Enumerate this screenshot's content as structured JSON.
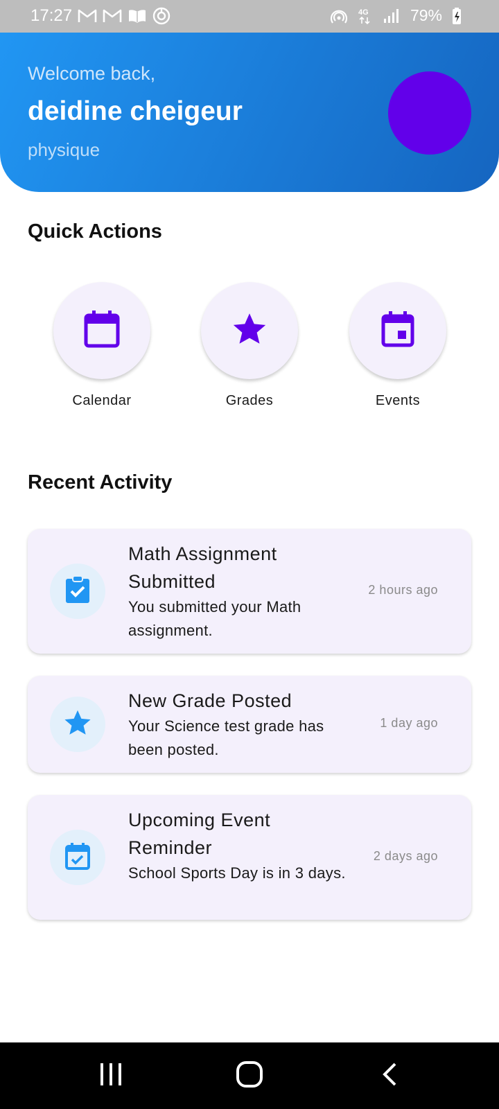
{
  "status_bar": {
    "time": "17:27",
    "battery": "79%",
    "left_icons": [
      "gmail-icon",
      "gmail-icon",
      "book-icon",
      "sync-icon"
    ],
    "right_icons": [
      "hotspot-icon",
      "network-4g-icon",
      "signal-icon",
      "battery-charging-icon"
    ],
    "network": "4G"
  },
  "header": {
    "welcome": "Welcome back,",
    "name": "deidine cheigeur",
    "subject": "physique",
    "avatar_color": "#6200ea",
    "gradient": [
      "#2196f3",
      "#1565c0"
    ]
  },
  "quick_actions": {
    "title": "Quick Actions",
    "items": [
      {
        "label": "Calendar",
        "icon": "calendar-icon"
      },
      {
        "label": "Grades",
        "icon": "star-icon"
      },
      {
        "label": "Events",
        "icon": "event-icon"
      }
    ],
    "icon_color": "#6200ea"
  },
  "recent_activity": {
    "title": "Recent Activity",
    "items": [
      {
        "title": "Math Assignment Submitted",
        "description": "You submitted your Math assignment.",
        "time": "2 hours ago",
        "icon": "assignment-check-icon"
      },
      {
        "title": "New Grade Posted",
        "description": "Your Science test grade has been posted.",
        "time": "1 day ago",
        "icon": "star-icon"
      },
      {
        "title": "Upcoming Event Reminder",
        "description": "School Sports Day is in 3 days.",
        "time": "2 days ago",
        "icon": "event-available-icon"
      }
    ],
    "icon_color": "#2196f3"
  },
  "nav_bar": {
    "buttons": [
      "recent-apps-icon",
      "home-icon",
      "back-icon"
    ]
  }
}
